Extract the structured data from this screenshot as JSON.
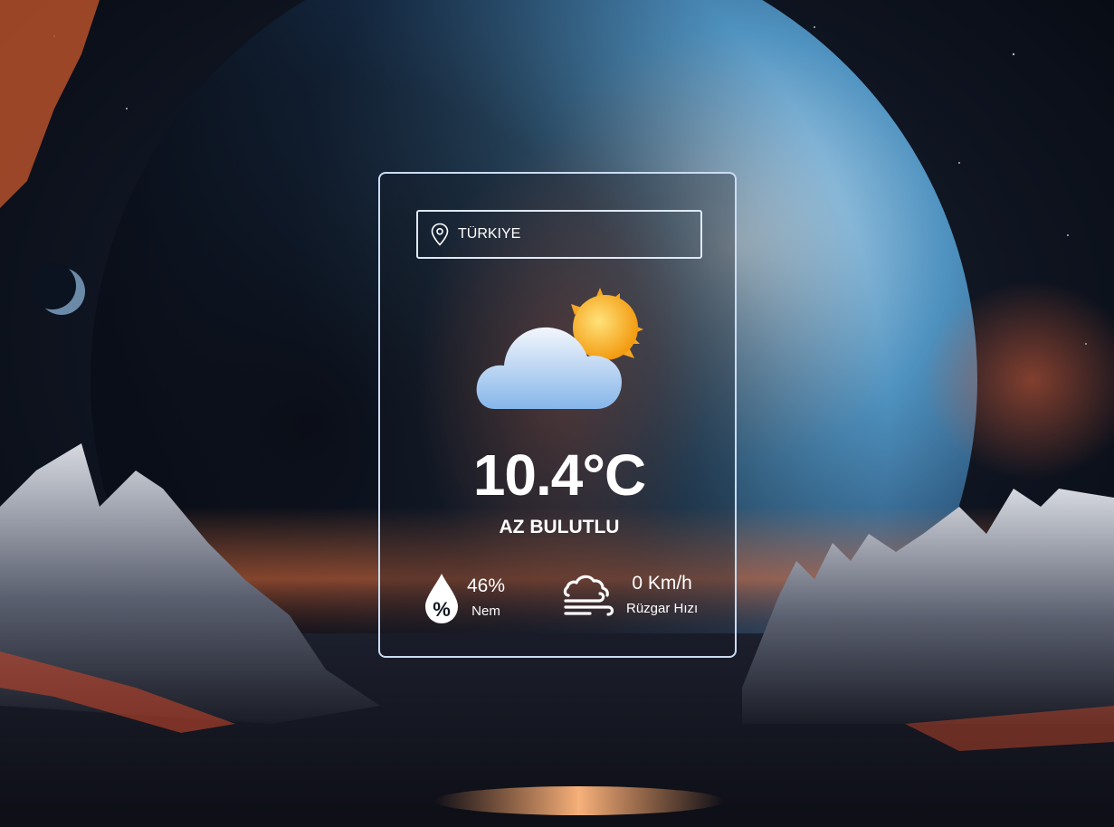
{
  "background": {
    "description_icon": "space-landscape-background"
  },
  "search": {
    "value": "TÜRKIYE",
    "icon": "location-pin-icon"
  },
  "weather": {
    "icon": "partly-cloudy-icon",
    "temperature": "10.4°C",
    "description": "AZ BULUTLU"
  },
  "stats": {
    "humidity": {
      "icon": "humidity-drop-icon",
      "value": "46%",
      "label": "Nem"
    },
    "wind": {
      "icon": "wind-icon",
      "value": "0 Km/h",
      "label": "Rüzgar Hızı"
    }
  },
  "colors": {
    "card_border": "#c9dcf3",
    "text": "#ffffff",
    "sun": "#f6b21a",
    "cloud": "#a9cdf2"
  }
}
